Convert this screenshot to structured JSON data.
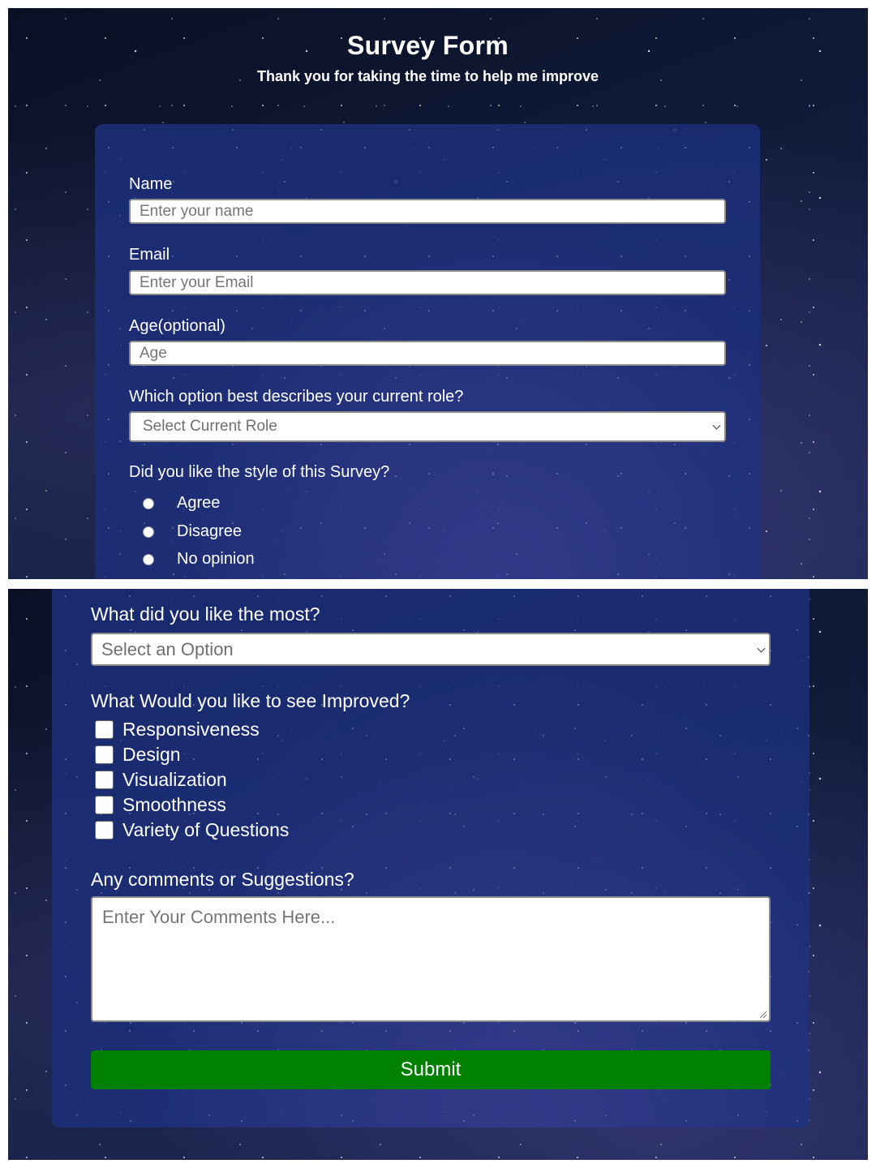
{
  "header": {
    "title": "Survey Form",
    "subtitle": "Thank you for taking the time to help me improve"
  },
  "fields": {
    "name": {
      "label": "Name",
      "placeholder": "Enter your name"
    },
    "email": {
      "label": "Email",
      "placeholder": "Enter your Email"
    },
    "age": {
      "label": "Age(optional)",
      "placeholder": "Age"
    },
    "role": {
      "label": "Which option best describes your current role?",
      "selected": "Select Current Role"
    },
    "style": {
      "label": "Did you like the style of this Survey?",
      "options": [
        "Agree",
        "Disagree",
        "No opinion"
      ]
    },
    "liked_most": {
      "label": "What did you like the most?",
      "selected": "Select an Option"
    },
    "improve": {
      "label": "What Would you like to see Improved?",
      "options": [
        "Responsiveness",
        "Design",
        "Visualization",
        "Smoothness",
        "Variety of Questions"
      ]
    },
    "comments": {
      "label": "Any comments or Suggestions?",
      "placeholder": "Enter Your Comments Here..."
    }
  },
  "submit_label": "Submit",
  "colors": {
    "panel": "#1c2e7a",
    "submit": "#008000",
    "background": "#0c1530"
  }
}
